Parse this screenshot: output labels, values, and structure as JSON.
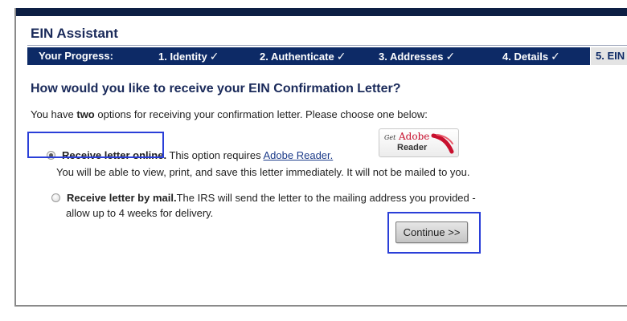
{
  "app": {
    "title": "EIN Assistant"
  },
  "progress": {
    "label": "Your Progress:",
    "steps": [
      {
        "label": "1. Identity",
        "check": "✓"
      },
      {
        "label": "2. Authenticate",
        "check": "✓"
      },
      {
        "label": "3. Addresses",
        "check": "✓"
      },
      {
        "label": "4. Details",
        "check": "✓"
      },
      {
        "label": "5. EIN"
      }
    ]
  },
  "main": {
    "heading": "How would you like to receive your EIN Confirmation Letter?",
    "intro_before": "You have ",
    "intro_bold": "two",
    "intro_after": " options for receiving your confirmation letter. Please choose one below:",
    "options": {
      "online": {
        "label": "Receive letter online.",
        "text": " This option requires ",
        "link": "Adobe Reader.",
        "subtext": "You will be able to view, print, and save this letter immediately. It will not be mailed to you.",
        "selected": true
      },
      "mail": {
        "label": "Receive letter by mail.",
        "text": "The IRS will send the letter to the mailing address you provided -",
        "subtext": "allow up to 4 weeks for delivery.",
        "selected": false
      }
    },
    "adobe_badge": {
      "get": "Get",
      "brand": "Adobe",
      "product": "Reader"
    },
    "continue_label": "Continue >>"
  },
  "colors": {
    "nav_bg": "#0d2a66",
    "top_bar": "#0d1f44",
    "heading": "#1a2a5a",
    "highlight": "#2a3fd8",
    "link": "#1d3c8a"
  }
}
